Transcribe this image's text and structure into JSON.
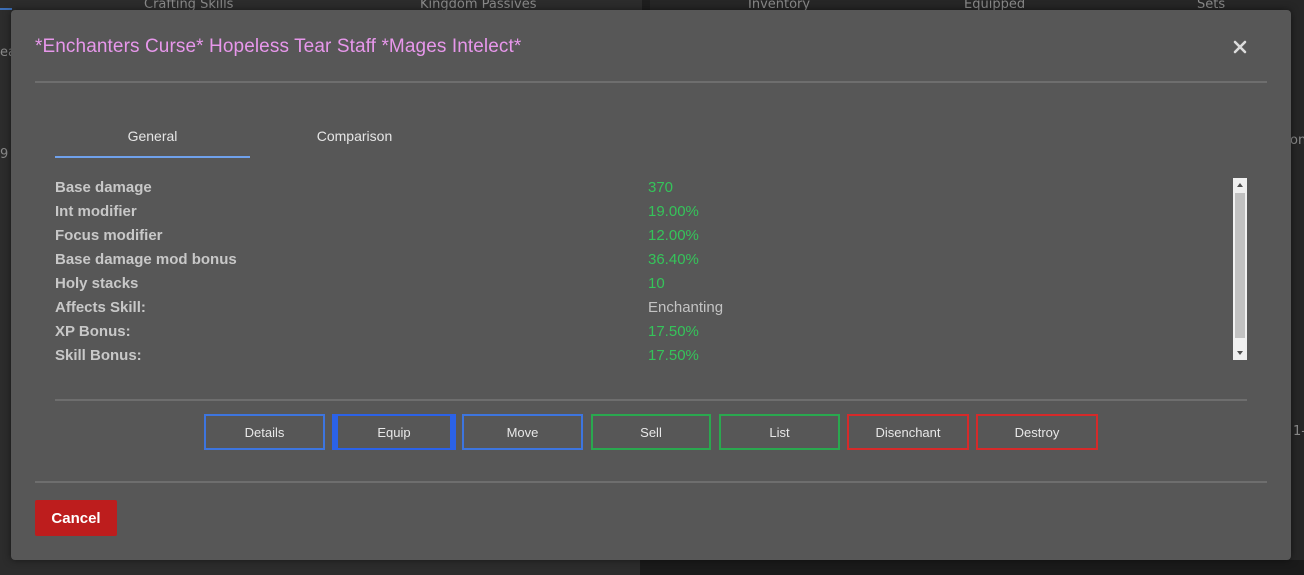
{
  "background": {
    "tabs_left": [
      "Crafting Skills",
      "Kingdom Passives"
    ],
    "tabs_right": [
      "Inventory",
      "Equipped",
      "Sets"
    ],
    "fragments": [
      "ea",
      "9",
      "on",
      "1-"
    ]
  },
  "modal": {
    "title": "*Enchanters Curse* Hopeless Tear Staff *Mages Intelect*",
    "close_icon": "close-icon"
  },
  "tabs": [
    {
      "label": "General",
      "active": true
    },
    {
      "label": "Comparison",
      "active": false
    }
  ],
  "stats": [
    {
      "label": "Base damage",
      "value": "370",
      "color": "green"
    },
    {
      "label": "Int modifier",
      "value": "19.00%",
      "color": "green"
    },
    {
      "label": "Focus modifier",
      "value": "12.00%",
      "color": "green"
    },
    {
      "label": "Base damage mod bonus",
      "value": "36.40%",
      "color": "green"
    },
    {
      "label": "Holy stacks",
      "value": "10",
      "color": "green"
    },
    {
      "label": "Affects Skill:",
      "value": "Enchanting",
      "color": "plain"
    },
    {
      "label": "XP Bonus:",
      "value": "17.50%",
      "color": "green"
    },
    {
      "label": "Skill Bonus:",
      "value": "17.50%",
      "color": "green"
    }
  ],
  "actions": [
    {
      "label": "Details",
      "style": "blue"
    },
    {
      "label": "Equip",
      "style": "blue-active"
    },
    {
      "label": "Move",
      "style": "blue"
    },
    {
      "label": "Sell",
      "style": "green"
    },
    {
      "label": "List",
      "style": "green"
    },
    {
      "label": "Disenchant",
      "style": "red"
    },
    {
      "label": "Destroy",
      "style": "red"
    }
  ],
  "footer": {
    "cancel_label": "Cancel"
  },
  "colors": {
    "title": "#e797eb",
    "value_green": "#35c45a",
    "btn_blue": "#3d75df",
    "btn_green": "#2aa84f",
    "btn_red": "#d62a2a",
    "cancel_bg": "#bd1d1d"
  }
}
